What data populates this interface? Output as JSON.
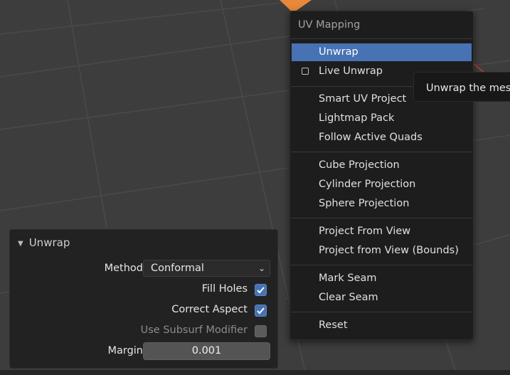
{
  "menu": {
    "title": "UV Mapping",
    "items": [
      {
        "label": "Unwrap",
        "highlighted": true
      },
      {
        "label": "Live Unwrap",
        "checkbox": true,
        "checked": false
      },
      {
        "label": "Smart UV Project"
      },
      {
        "label": "Lightmap Pack"
      },
      {
        "label": "Follow Active Quads"
      },
      {
        "label": "Cube Projection"
      },
      {
        "label": "Cylinder Projection"
      },
      {
        "label": "Sphere Projection"
      },
      {
        "label": "Project From View"
      },
      {
        "label": "Project from View (Bounds)"
      },
      {
        "label": "Mark Seam"
      },
      {
        "label": "Clear Seam"
      },
      {
        "label": "Reset"
      }
    ]
  },
  "tooltip": {
    "text": "Unwrap the mesh"
  },
  "panel": {
    "title": "Unwrap",
    "method_label": "Method",
    "method_value": "Conformal",
    "fill_holes_label": "Fill Holes",
    "fill_holes_checked": true,
    "correct_aspect_label": "Correct Aspect",
    "correct_aspect_checked": true,
    "subsurf_label": "Use Subsurf Modifier",
    "subsurf_checked": false,
    "margin_label": "Margin",
    "margin_value": "0.001"
  },
  "colors": {
    "accent": "#4772b3",
    "selected_object": "#e8883a",
    "background": "#3d3d3d"
  }
}
